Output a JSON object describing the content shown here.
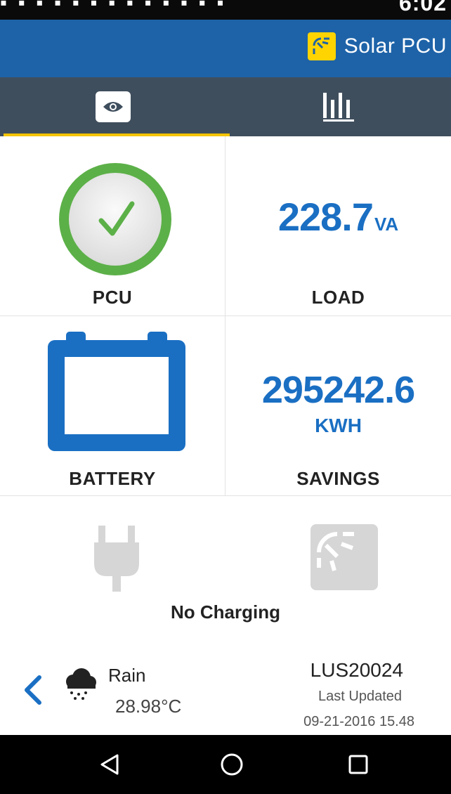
{
  "status_bar": {
    "time": "6:02",
    "icons": [
      "sd-card-icon",
      "notification-icon",
      "image-icon",
      "chat-icon",
      "phone-icon",
      "wifi-icon",
      "signal-icon",
      "battery-icon"
    ]
  },
  "app_bar": {
    "title": "Solar PCU",
    "logo": "solar-panel-logo-icon",
    "background": "#1e63a8",
    "logo_color": "#ffd400"
  },
  "tabs": [
    {
      "icon": "eye-icon",
      "selected": true
    },
    {
      "icon": "bar-chart-icon",
      "selected": false
    }
  ],
  "tab_indicator_color": "#f4c400",
  "tiles": {
    "pcu": {
      "label": "PCU",
      "status": "ok",
      "icon": "check-circle-icon",
      "color": "#5cb048"
    },
    "load": {
      "label": "LOAD",
      "value": "228.7",
      "unit": "VA"
    },
    "battery": {
      "label": "BATTERY",
      "icon": "battery-outline-icon"
    },
    "savings": {
      "label": "SAVINGS",
      "value": "295242.6",
      "unit": "KWH"
    }
  },
  "value_color": "#1a6fc3",
  "charging": {
    "status": "No Charging",
    "grid_icon": "plug-icon",
    "solar_icon": "solar-panel-icon",
    "inactive_color": "#d6d6d6"
  },
  "footer": {
    "weather": {
      "condition": "Rain",
      "temperature": "28.98°C",
      "icon": "rain-cloud-icon"
    },
    "device_id": "LUS20024",
    "updated_label": "Last Updated",
    "updated_time": "09-21-2016 15.48"
  },
  "nav_bar": {
    "buttons": [
      "back-triangle-icon",
      "home-circle-icon",
      "recents-square-icon"
    ]
  }
}
